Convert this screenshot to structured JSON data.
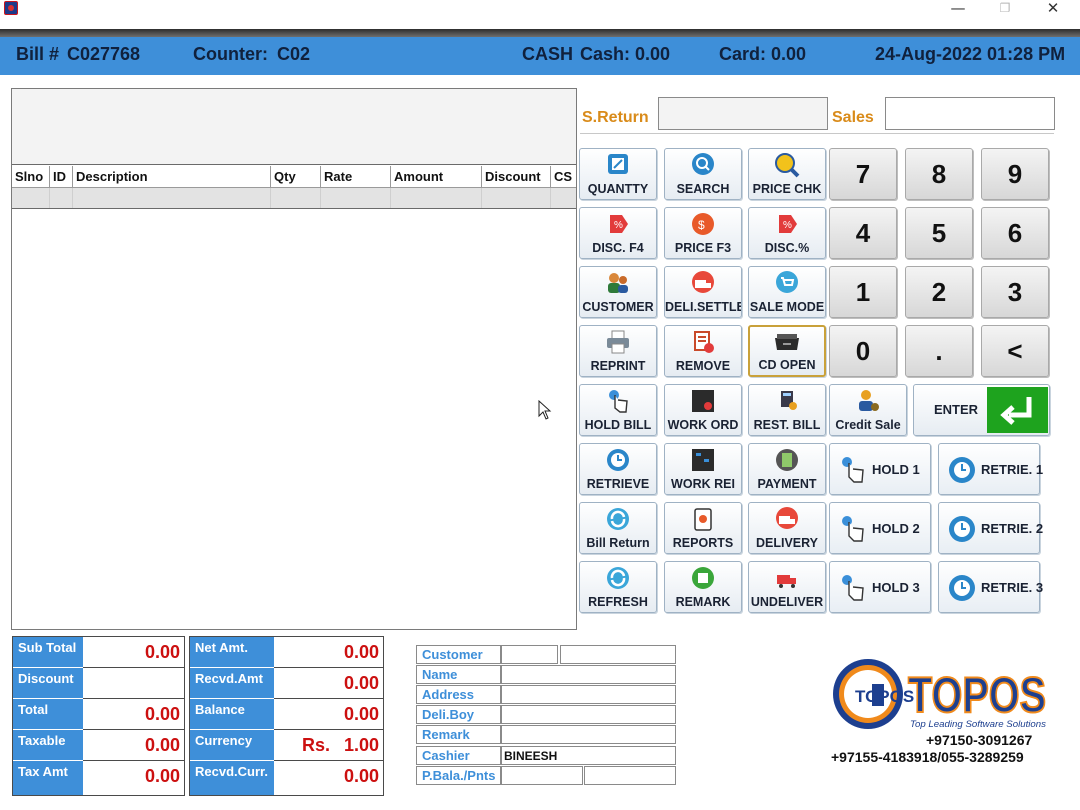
{
  "window": {
    "minimize_glyph": "—",
    "maximize_glyph": "❐",
    "close_glyph": "✕"
  },
  "header": {
    "bill_label": "Bill #",
    "bill_no": "C027768",
    "counter_label": "Counter:",
    "counter": "C02",
    "pay_mode": "CASH",
    "cash": "Cash: 0.00",
    "card": "Card: 0.00",
    "datetime": "24-Aug-2022  01:28 PM",
    "color": "#3e8fd9"
  },
  "grid": {
    "columns": [
      "Slno",
      "ID",
      "Description",
      "Qty",
      "Rate",
      "Amount",
      "Discount",
      "CS C"
    ]
  },
  "return_sales": {
    "return_label": "S.Return",
    "return_value": "",
    "sales_label": "Sales",
    "sales_value": ""
  },
  "functions": {
    "quantity": "QUANTTY",
    "search": "SEARCH",
    "price_chk": "PRICE CHK",
    "disc_f4": "DISC. F4",
    "price_f3": "PRICE F3",
    "disc_pct": "DISC.%",
    "customer": "CUSTOMER",
    "deli_settle": "DELI.SETTLE",
    "sale_mode": "SALE MODE",
    "reprint": "REPRINT",
    "remove": "REMOVE",
    "cd_open": "CD OPEN",
    "hold_bill": "HOLD BILL",
    "work_ord": "WORK ORD",
    "rest_bill": "REST. BILL",
    "credit_sale": "Credit Sale",
    "enter": "ENTER",
    "retrieve": "RETRIEVE",
    "work_rei": "WORK REI",
    "payment": "PAYMENT",
    "bill_return": "Bill Return",
    "reports": "REPORTS",
    "delivery": "DELIVERY",
    "refresh": "REFRESH",
    "remark": "REMARK",
    "undeliver": "UNDELIVER",
    "hold1": "HOLD 1",
    "hold2": "HOLD 2",
    "hold3": "HOLD 3",
    "retrie1": "RETRIE. 1",
    "retrie2": "RETRIE. 2",
    "retrie3": "RETRIE. 3"
  },
  "numpad": {
    "k7": "7",
    "k8": "8",
    "k9": "9",
    "k4": "4",
    "k5": "5",
    "k6": "6",
    "k1": "1",
    "k2": "2",
    "k3": "3",
    "k0": "0",
    "kdot": ".",
    "kback": "<"
  },
  "totals": {
    "sub_total_label": "Sub Total",
    "sub_total": "0.00",
    "discount_label": "Discount",
    "discount": "",
    "total_label": "Total",
    "total": "0.00",
    "taxable_label": "Taxable",
    "taxable": "0.00",
    "tax_amt_label": "Tax Amt",
    "tax_amt": "0.00",
    "net_amt_label": "Net Amt.",
    "net_amt": "0.00",
    "recvd_amt_label": "Recvd.Amt",
    "recvd_amt": "0.00",
    "balance_label": "Balance",
    "balance": "0.00",
    "currency_label": "Currency",
    "currency_symbol": "Rs.",
    "currency_rate": "1.00",
    "recvd_curr_label": "Recvd.Curr.",
    "recvd_curr": "0.00"
  },
  "customer_info": {
    "customer_label": "Customer",
    "customer": "",
    "name_label": "Name",
    "name": "",
    "address_label": "Address",
    "address": "",
    "deli_boy_label": "Deli.Boy",
    "deli_boy": "",
    "remark_label": "Remark",
    "remark": "",
    "cashier_label": "Cashier",
    "cashier": "BINEESH",
    "bal_pnts_label": "P.Bala./Pnts",
    "bal": "",
    "pnts": ""
  },
  "brand": {
    "logo_badge": "TOPOS",
    "logo_text": "TOPOS",
    "tagline": "Top Leading Software Solutions",
    "phone1": "+97150-3091267",
    "phone2": "+97155-4183918/055-3289259",
    "orange": "#f08a1c",
    "navy": "#1d3f8f"
  }
}
